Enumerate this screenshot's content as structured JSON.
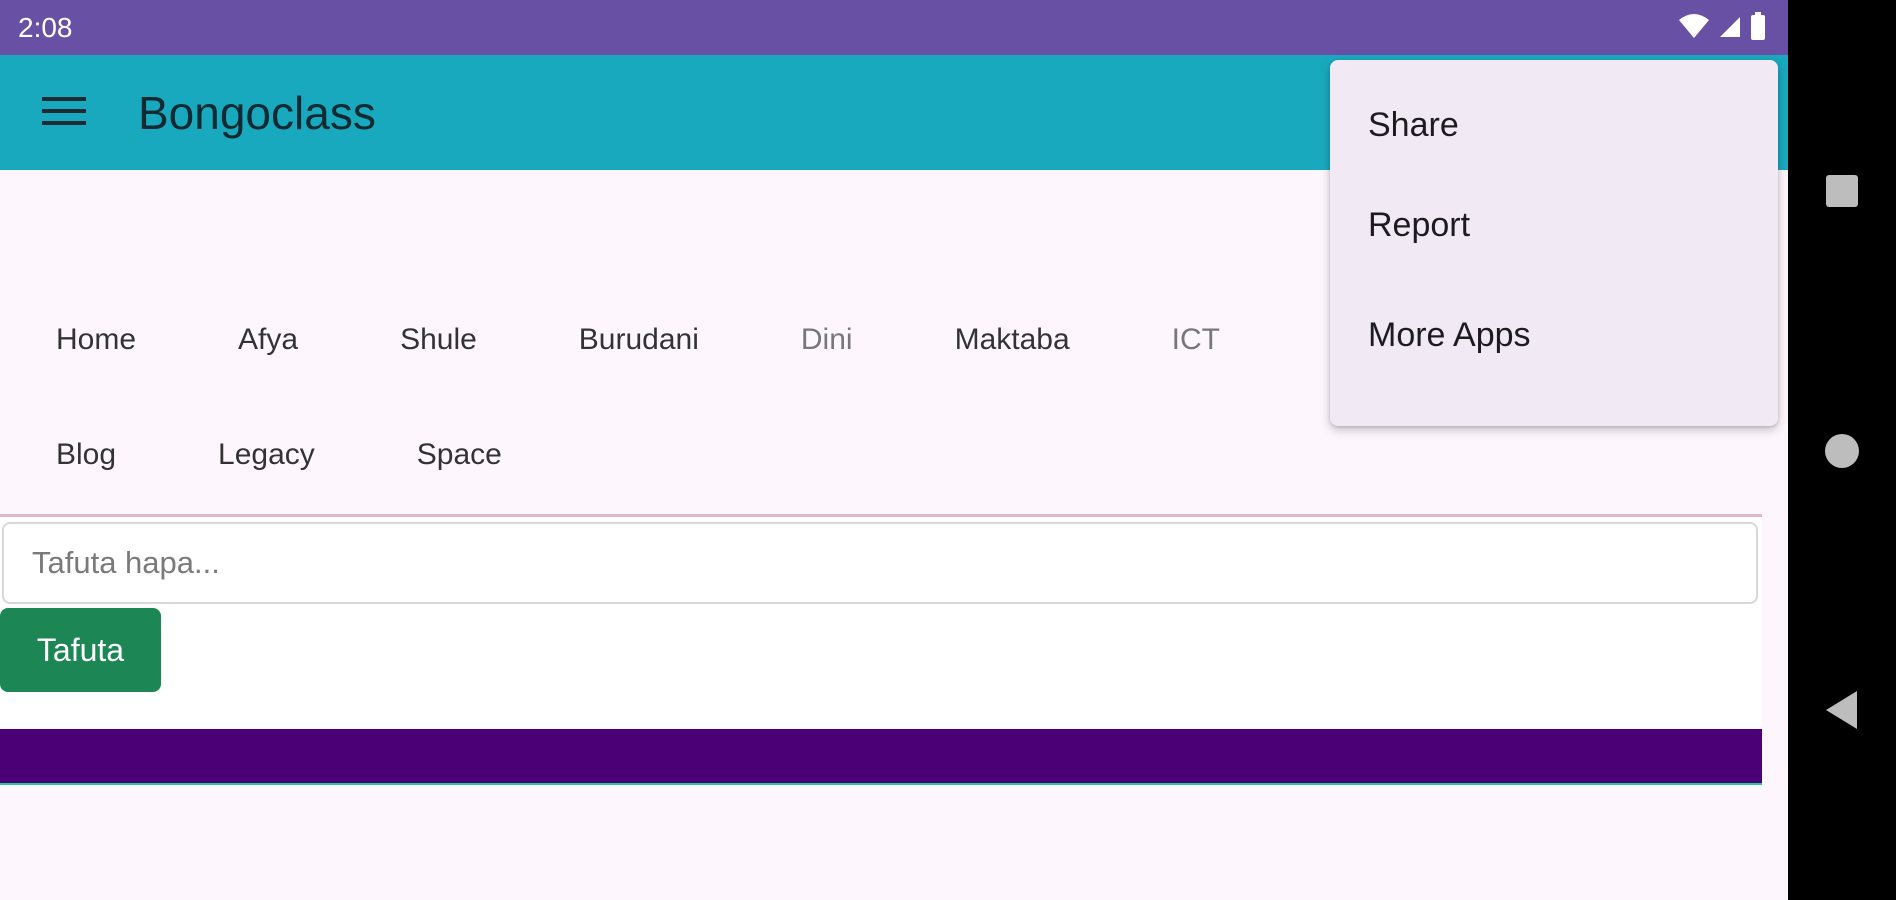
{
  "status_bar": {
    "time": "2:08",
    "icons": [
      "wifi-icon",
      "signal-icon",
      "battery-icon"
    ],
    "background": "#6850a4"
  },
  "app_bar": {
    "title": "Bongoclass",
    "menu_icon": "hamburger-menu-icon",
    "background": "#19a9be"
  },
  "nav": {
    "row1": [
      {
        "label": "Home"
      },
      {
        "label": "Afya"
      },
      {
        "label": "Shule"
      },
      {
        "label": "Burudani"
      },
      {
        "label": "Dini"
      },
      {
        "label": "Maktaba"
      },
      {
        "label": "ICT"
      }
    ],
    "row2": [
      {
        "label": "Blog"
      },
      {
        "label": "Legacy"
      },
      {
        "label": "Space"
      }
    ]
  },
  "search": {
    "placeholder": "Tafuta hapa...",
    "value": "",
    "button_label": "Tafuta",
    "button_color": "#1c8754"
  },
  "overflow_menu": {
    "items": [
      {
        "label": "Share"
      },
      {
        "label": "Report"
      },
      {
        "label": "More Apps"
      }
    ]
  },
  "system_nav": {
    "buttons": [
      "recents-icon",
      "home-icon",
      "back-icon"
    ]
  },
  "colors": {
    "purple_bar": "#4b0076",
    "menu_background": "#f1e9f4"
  }
}
